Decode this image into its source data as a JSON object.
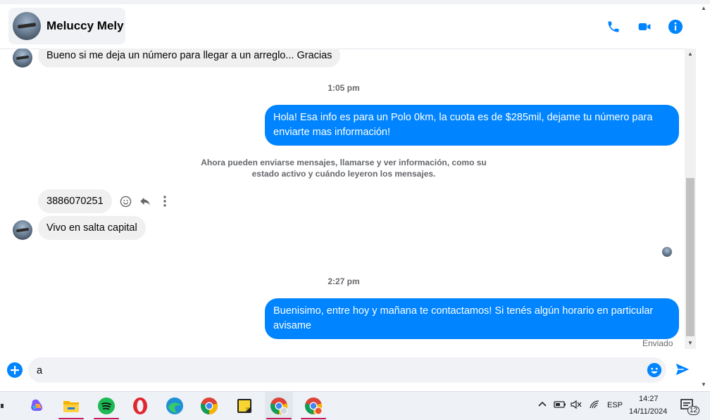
{
  "header": {
    "contact_name": "Meluccy Mely",
    "icons": [
      "phone-icon",
      "video-icon",
      "info-icon"
    ],
    "accent": "#0084ff"
  },
  "messages": {
    "in_1": "Bueno si me deja un número para llegar a un arreglo... Gracias",
    "ts_1": "1:05 pm",
    "out_1": "Hola! Esa info es para un Polo 0km, la cuota es de $285mil, dejame tu número para enviarte mas información!",
    "notice": "Ahora pueden enviarse mensajes, llamarse y ver información, como su estado activo y cuándo leyeron los mensajes.",
    "in_2": "3886070251",
    "in_3": "Vivo en salta capital",
    "ts_2": "2:27 pm",
    "out_2": "Buenisimo, entre hoy y mañana te contactamos! Si tenés algún horario en particular avisame",
    "status": "Enviado"
  },
  "composer": {
    "value": "a"
  },
  "taskbar": {
    "apps": [
      "task-view-icon",
      "copilot-icon",
      "file-explorer-icon",
      "spotify-icon",
      "opera-icon",
      "edge-icon",
      "chrome-icon",
      "sticky-notes-icon",
      "chrome-profile-icon",
      "chrome-profile-2-icon"
    ],
    "lang": "ESP",
    "time": "14:27",
    "date": "14/11/2024",
    "notif_count": "12"
  }
}
